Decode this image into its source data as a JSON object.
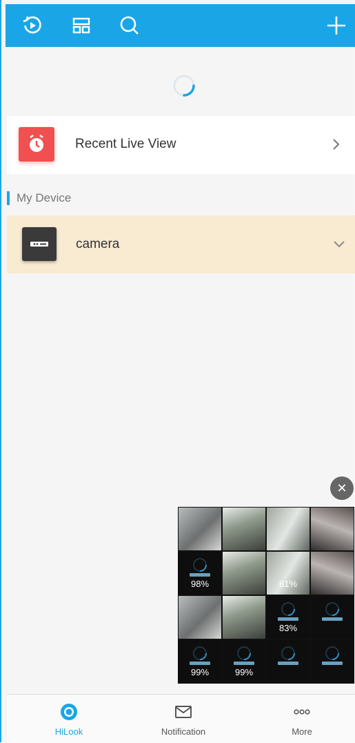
{
  "colors": {
    "primary": "#1aa6e6",
    "recent_icon": "#f05050",
    "device_row_bg": "#f8ebd2",
    "nav_active": "#1aa6e6",
    "nav_inactive": "#555555"
  },
  "topbar": {
    "icons": [
      "playback-icon",
      "layout-icon",
      "search-icon",
      "add-icon"
    ]
  },
  "recent": {
    "label": "Recent Live View"
  },
  "section": {
    "label": "My Device"
  },
  "device": {
    "name": "camera"
  },
  "preview": {
    "tiles": [
      {
        "type": "video",
        "pct": ""
      },
      {
        "type": "video",
        "pct": ""
      },
      {
        "type": "video",
        "pct": ""
      },
      {
        "type": "video",
        "pct": ""
      },
      {
        "type": "dark",
        "pct": "98%"
      },
      {
        "type": "video",
        "pct": ""
      },
      {
        "type": "video",
        "pct": "61%"
      },
      {
        "type": "video",
        "pct": ""
      },
      {
        "type": "video",
        "pct": ""
      },
      {
        "type": "video",
        "pct": ""
      },
      {
        "type": "dark",
        "pct": "83%"
      },
      {
        "type": "dark",
        "pct": ""
      },
      {
        "type": "dark",
        "pct": "99%"
      },
      {
        "type": "dark",
        "pct": "99%"
      },
      {
        "type": "dark",
        "pct": ""
      },
      {
        "type": "dark",
        "pct": ""
      }
    ]
  },
  "nav": {
    "items": [
      {
        "label": "HiLook",
        "icon": "home-icon",
        "active": true
      },
      {
        "label": "Notification",
        "icon": "mail-icon",
        "active": false
      },
      {
        "label": "More",
        "icon": "more-icon",
        "active": false
      }
    ]
  }
}
